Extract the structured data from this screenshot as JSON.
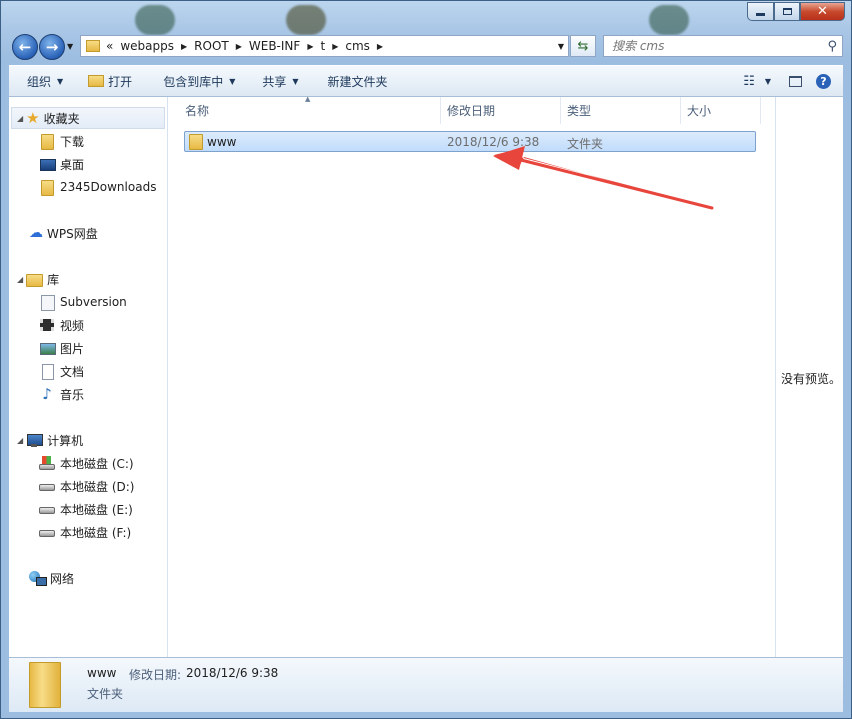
{
  "window": {
    "minimize_icon": "minimize-icon",
    "maximize_icon": "maximize-icon",
    "close_icon": "close-icon"
  },
  "address_bar": {
    "overflow": "«",
    "crumbs": [
      "webapps",
      "ROOT",
      "WEB-INF",
      "t",
      "cms"
    ]
  },
  "search": {
    "placeholder": "搜索 cms"
  },
  "toolbar": {
    "organize": "组织",
    "open": "打开",
    "include_in_library": "包含到库中",
    "share": "共享",
    "new_folder": "新建文件夹"
  },
  "nav_pane": {
    "favorites": {
      "label": "收藏夹",
      "items": [
        "下载",
        "桌面",
        "2345Downloads"
      ]
    },
    "wps": "WPS网盘",
    "libraries": {
      "label": "库",
      "items": [
        "Subversion",
        "视频",
        "图片",
        "文档",
        "音乐"
      ]
    },
    "computer": {
      "label": "计算机",
      "items": [
        "本地磁盘 (C:)",
        "本地磁盘 (D:)",
        "本地磁盘 (E:)",
        "本地磁盘 (F:)"
      ]
    },
    "network": "网络"
  },
  "columns": {
    "name": "名称",
    "modified": "修改日期",
    "type": "类型",
    "size": "大小"
  },
  "files": [
    {
      "name": "www",
      "modified": "2018/12/6 9:38",
      "type": "文件夹",
      "size": ""
    }
  ],
  "preview": {
    "text": "没有预览。"
  },
  "details": {
    "name": "www",
    "modified_label": "修改日期:",
    "modified_value": "2018/12/6 9:38",
    "type": "文件夹"
  },
  "colors": {
    "selection": "#c1dcfc",
    "arrow": "#e8463c",
    "link": "#1e395b"
  }
}
